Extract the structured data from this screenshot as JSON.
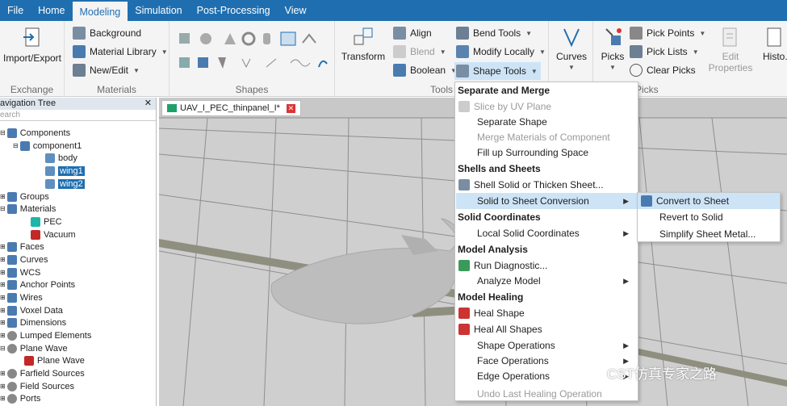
{
  "tabs": [
    "File",
    "Home",
    "Modeling",
    "Simulation",
    "Post-Processing",
    "View"
  ],
  "active_tab": "Modeling",
  "ribbon": {
    "exchange": {
      "label": "Exchange",
      "import_export": "Import/Export"
    },
    "materials": {
      "label": "Materials",
      "background": "Background",
      "material_library": "Material Library",
      "new_edit": "New/Edit"
    },
    "shapes": {
      "label": "Shapes"
    },
    "tools": {
      "label": "Tools",
      "transform": "Transform",
      "align": "Align",
      "blend": "Blend",
      "boolean": "Boolean",
      "bend_tools": "Bend Tools",
      "modify_locally": "Modify Locally",
      "shape_tools": "Shape Tools"
    },
    "curves": {
      "label": "Curves"
    },
    "picks": {
      "label": "Picks",
      "picks": "Picks",
      "pick_points": "Pick Points",
      "pick_lists": "Pick Lists",
      "clear_picks": "Clear Picks",
      "edit_properties": "Edit Properties",
      "history": "Histo..."
    }
  },
  "tree": {
    "header": "avigation Tree",
    "search_placeholder": "earch",
    "items": {
      "components": "Components",
      "component1": "component1",
      "body": "body",
      "wing1": "wing1",
      "wing2": "wing2",
      "groups": "Groups",
      "materials": "Materials",
      "pec": "PEC",
      "vacuum": "Vacuum",
      "faces": "Faces",
      "curves": "Curves",
      "wcs": "WCS",
      "anchor_points": "Anchor Points",
      "wires": "Wires",
      "voxel_data": "Voxel Data",
      "dimensions": "Dimensions",
      "lumped_elements": "Lumped Elements",
      "plane_wave": "Plane Wave",
      "plane_wave_child": "Plane Wave",
      "farfield_sources": "Farfield Sources",
      "field_sources": "Field Sources",
      "ports": "Ports"
    }
  },
  "doc_tab": "UAV_I_PEC_thinpanel_I*",
  "menu": {
    "h1": "Separate and Merge",
    "i1": "Slice by UV Plane",
    "i2": "Separate Shape",
    "i3": "Merge Materials of Component",
    "i4": "Fill up Surrounding Space",
    "h2": "Shells and Sheets",
    "i5": "Shell Solid or Thicken Sheet...",
    "i6": "Solid to Sheet Conversion",
    "h3": "Solid Coordinates",
    "i7": "Local Solid Coordinates",
    "h4": "Model Analysis",
    "i8": "Run Diagnostic...",
    "i9": "Analyze Model",
    "h5": "Model Healing",
    "i10": "Heal Shape",
    "i11": "Heal All Shapes",
    "i12": "Shape Operations",
    "i13": "Face Operations",
    "i14": "Edge Operations",
    "i15": "Undo Last Healing Operation"
  },
  "submenu": {
    "s1": "Convert to Sheet",
    "s2": "Revert to Solid",
    "s3": "Simplify Sheet Metal..."
  },
  "watermark": "CST仿真专家之路",
  "colors": {
    "accent": "#1f6fb0",
    "highlight": "#cde4f7"
  }
}
